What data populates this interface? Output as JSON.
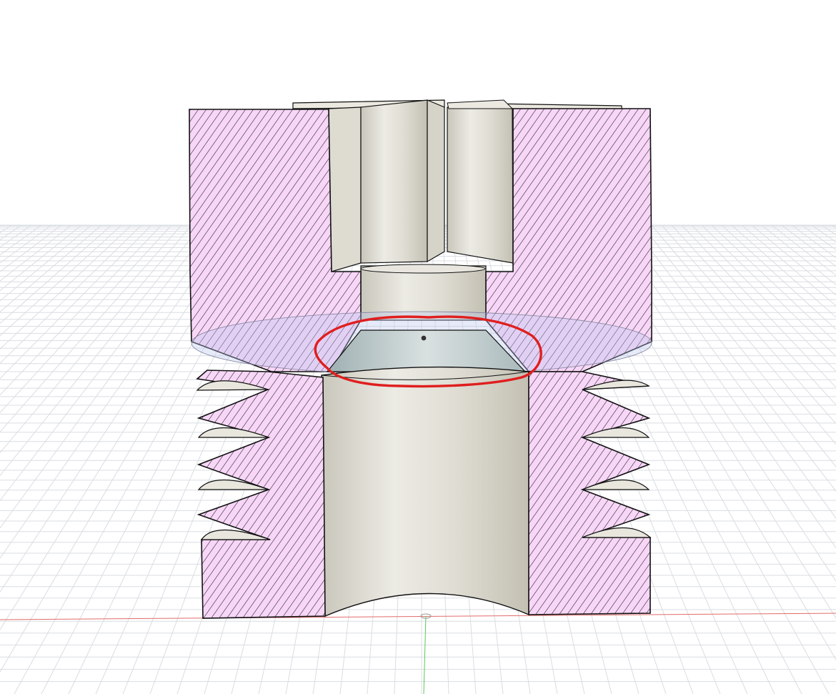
{
  "viewport": {
    "title": "",
    "background_color": "#ffffff",
    "grid_color": "#d9dde2",
    "x_axis_color": "#e26b6b",
    "y_axis_color": "#5cc85c"
  },
  "model": {
    "section_hatch_color": "#f7d6f7",
    "hatch_line_color": "#1a1a1a",
    "solid_color": "#e7e5dd",
    "section_plane_color": "#b9c7ee",
    "annotation": {
      "shape": "freehand-circle",
      "color": "#e01e1e"
    }
  }
}
